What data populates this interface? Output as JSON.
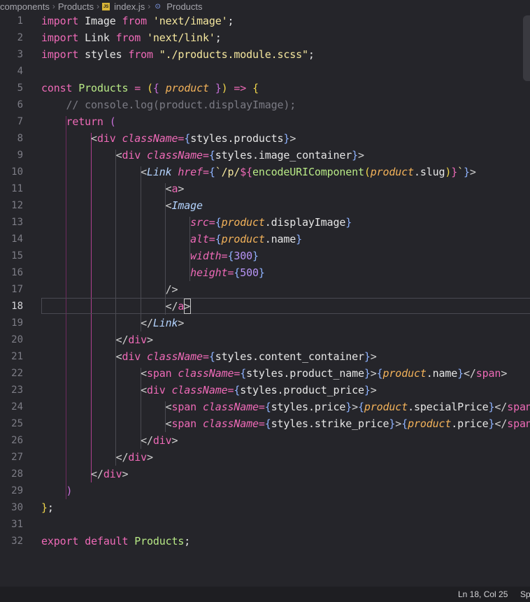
{
  "breadcrumb": {
    "items": [
      "components",
      "Products",
      "index.js",
      "Products"
    ],
    "file_badge": "JS"
  },
  "editor": {
    "active_line": 18,
    "lines": [
      {
        "n": "1",
        "tokens": [
          [
            "kw",
            "import"
          ],
          [
            "tx",
            " Image "
          ],
          [
            "kw",
            "from"
          ],
          [
            "tx",
            " "
          ],
          [
            "str",
            "'next/image'"
          ],
          [
            "tx",
            ";"
          ]
        ]
      },
      {
        "n": "2",
        "tokens": [
          [
            "kw",
            "import"
          ],
          [
            "tx",
            " Link "
          ],
          [
            "kw",
            "from"
          ],
          [
            "tx",
            " "
          ],
          [
            "str",
            "'next/link'"
          ],
          [
            "tx",
            ";"
          ]
        ]
      },
      {
        "n": "3",
        "tokens": [
          [
            "kw",
            "import"
          ],
          [
            "tx",
            " styles "
          ],
          [
            "kw",
            "from"
          ],
          [
            "tx",
            " "
          ],
          [
            "str",
            "\"./products.module.scss\""
          ],
          [
            "tx",
            ";"
          ]
        ]
      },
      {
        "n": "4",
        "tokens": []
      },
      {
        "n": "5",
        "tokens": [
          [
            "kw",
            "const"
          ],
          [
            "tx",
            " "
          ],
          [
            "fn",
            "Products"
          ],
          [
            "tx",
            " "
          ],
          [
            "kw",
            "="
          ],
          [
            "tx",
            " "
          ],
          [
            "br",
            "("
          ],
          [
            "br2",
            "{"
          ],
          [
            "tx",
            " "
          ],
          [
            "pm",
            "product"
          ],
          [
            "tx",
            " "
          ],
          [
            "br2",
            "}"
          ],
          [
            "br",
            ")"
          ],
          [
            "tx",
            " "
          ],
          [
            "kw",
            "=>"
          ],
          [
            "tx",
            " "
          ],
          [
            "br",
            "{"
          ]
        ]
      },
      {
        "n": "6",
        "tokens": [
          [
            "tx",
            "    "
          ],
          [
            "cm",
            "// console.log(product.displayImage);"
          ]
        ]
      },
      {
        "n": "7",
        "tokens": [
          [
            "tx",
            "    "
          ],
          [
            "kw",
            "return"
          ],
          [
            "tx",
            " "
          ],
          [
            "br2",
            "("
          ]
        ]
      },
      {
        "n": "8",
        "tokens": [
          [
            "tx",
            "        "
          ],
          [
            "pu",
            "<"
          ],
          [
            "tag",
            "div"
          ],
          [
            "tx",
            " "
          ],
          [
            "attr",
            "className"
          ],
          [
            "kw",
            "="
          ],
          [
            "br3",
            "{"
          ],
          [
            "tx",
            "styles.products"
          ],
          [
            "br3",
            "}"
          ],
          [
            "pu",
            ">"
          ]
        ]
      },
      {
        "n": "9",
        "tokens": [
          [
            "tx",
            "            "
          ],
          [
            "pu",
            "<"
          ],
          [
            "tag",
            "div"
          ],
          [
            "tx",
            " "
          ],
          [
            "attr",
            "className"
          ],
          [
            "kw",
            "="
          ],
          [
            "br3",
            "{"
          ],
          [
            "tx",
            "styles.image_container"
          ],
          [
            "br3",
            "}"
          ],
          [
            "pu",
            ">"
          ]
        ]
      },
      {
        "n": "10",
        "tokens": [
          [
            "tx",
            "                "
          ],
          [
            "pu",
            "<"
          ],
          [
            "comp",
            "Link"
          ],
          [
            "tx",
            " "
          ],
          [
            "attr",
            "href"
          ],
          [
            "kw",
            "="
          ],
          [
            "br3",
            "{"
          ],
          [
            "str",
            "`/p/"
          ],
          [
            "kw",
            "${"
          ],
          [
            "fn",
            "encodeURIComponent"
          ],
          [
            "br",
            "("
          ],
          [
            "pm",
            "product"
          ],
          [
            "tx",
            ".slug"
          ],
          [
            "br",
            ")"
          ],
          [
            "kw",
            "}"
          ],
          [
            "str",
            "`"
          ],
          [
            "br3",
            "}"
          ],
          [
            "pu",
            ">"
          ]
        ]
      },
      {
        "n": "11",
        "tokens": [
          [
            "tx",
            "                    "
          ],
          [
            "pu",
            "<"
          ],
          [
            "tag",
            "a"
          ],
          [
            "pu",
            ">"
          ]
        ]
      },
      {
        "n": "12",
        "tokens": [
          [
            "tx",
            "                    "
          ],
          [
            "pu",
            "<"
          ],
          [
            "comp",
            "Image"
          ]
        ]
      },
      {
        "n": "13",
        "tokens": [
          [
            "tx",
            "                        "
          ],
          [
            "attr",
            "src"
          ],
          [
            "kw",
            "="
          ],
          [
            "br3",
            "{"
          ],
          [
            "pm",
            "product"
          ],
          [
            "tx",
            ".displayImage"
          ],
          [
            "br3",
            "}"
          ]
        ]
      },
      {
        "n": "14",
        "tokens": [
          [
            "tx",
            "                        "
          ],
          [
            "attr",
            "alt"
          ],
          [
            "kw",
            "="
          ],
          [
            "br3",
            "{"
          ],
          [
            "pm",
            "product"
          ],
          [
            "tx",
            ".name"
          ],
          [
            "br3",
            "}"
          ]
        ]
      },
      {
        "n": "15",
        "tokens": [
          [
            "tx",
            "                        "
          ],
          [
            "attr",
            "width"
          ],
          [
            "kw",
            "="
          ],
          [
            "br3",
            "{"
          ],
          [
            "num",
            "300"
          ],
          [
            "br3",
            "}"
          ]
        ]
      },
      {
        "n": "16",
        "tokens": [
          [
            "tx",
            "                        "
          ],
          [
            "attr",
            "height"
          ],
          [
            "kw",
            "="
          ],
          [
            "br3",
            "{"
          ],
          [
            "num",
            "500"
          ],
          [
            "br3",
            "}"
          ]
        ]
      },
      {
        "n": "17",
        "tokens": [
          [
            "tx",
            "                    "
          ],
          [
            "pu",
            "/>"
          ]
        ]
      },
      {
        "n": "18",
        "tokens": [
          [
            "tx",
            "                    "
          ],
          [
            "pu",
            "</"
          ],
          [
            "tag",
            "a"
          ],
          [
            "pu",
            ">"
          ]
        ]
      },
      {
        "n": "19",
        "tokens": [
          [
            "tx",
            "                "
          ],
          [
            "pu",
            "</"
          ],
          [
            "comp",
            "Link"
          ],
          [
            "pu",
            ">"
          ]
        ]
      },
      {
        "n": "20",
        "tokens": [
          [
            "tx",
            "            "
          ],
          [
            "pu",
            "</"
          ],
          [
            "tag",
            "div"
          ],
          [
            "pu",
            ">"
          ]
        ]
      },
      {
        "n": "21",
        "tokens": [
          [
            "tx",
            "            "
          ],
          [
            "pu",
            "<"
          ],
          [
            "tag",
            "div"
          ],
          [
            "tx",
            " "
          ],
          [
            "attr",
            "className"
          ],
          [
            "kw",
            "="
          ],
          [
            "br3",
            "{"
          ],
          [
            "tx",
            "styles.content_container"
          ],
          [
            "br3",
            "}"
          ],
          [
            "pu",
            ">"
          ]
        ]
      },
      {
        "n": "22",
        "tokens": [
          [
            "tx",
            "                "
          ],
          [
            "pu",
            "<"
          ],
          [
            "tag",
            "span"
          ],
          [
            "tx",
            " "
          ],
          [
            "attr",
            "className"
          ],
          [
            "kw",
            "="
          ],
          [
            "br3",
            "{"
          ],
          [
            "tx",
            "styles.product_name"
          ],
          [
            "br3",
            "}"
          ],
          [
            "pu",
            ">"
          ],
          [
            "br3",
            "{"
          ],
          [
            "pm",
            "product"
          ],
          [
            "tx",
            ".name"
          ],
          [
            "br3",
            "}"
          ],
          [
            "pu",
            "</"
          ],
          [
            "tag",
            "span"
          ],
          [
            "pu",
            ">"
          ]
        ]
      },
      {
        "n": "23",
        "tokens": [
          [
            "tx",
            "                "
          ],
          [
            "pu",
            "<"
          ],
          [
            "tag",
            "div"
          ],
          [
            "tx",
            " "
          ],
          [
            "attr",
            "className"
          ],
          [
            "kw",
            "="
          ],
          [
            "br3",
            "{"
          ],
          [
            "tx",
            "styles.product_price"
          ],
          [
            "br3",
            "}"
          ],
          [
            "pu",
            ">"
          ]
        ]
      },
      {
        "n": "24",
        "tokens": [
          [
            "tx",
            "                    "
          ],
          [
            "pu",
            "<"
          ],
          [
            "tag",
            "span"
          ],
          [
            "tx",
            " "
          ],
          [
            "attr",
            "className"
          ],
          [
            "kw",
            "="
          ],
          [
            "br3",
            "{"
          ],
          [
            "tx",
            "styles.price"
          ],
          [
            "br3",
            "}"
          ],
          [
            "pu",
            ">"
          ],
          [
            "br3",
            "{"
          ],
          [
            "pm",
            "product"
          ],
          [
            "tx",
            ".specialPrice"
          ],
          [
            "br3",
            "}"
          ],
          [
            "pu",
            "</"
          ],
          [
            "tag",
            "span"
          ],
          [
            "pu",
            ">"
          ]
        ]
      },
      {
        "n": "25",
        "tokens": [
          [
            "tx",
            "                    "
          ],
          [
            "pu",
            "<"
          ],
          [
            "tag",
            "span"
          ],
          [
            "tx",
            " "
          ],
          [
            "attr",
            "className"
          ],
          [
            "kw",
            "="
          ],
          [
            "br3",
            "{"
          ],
          [
            "tx",
            "styles.strike_price"
          ],
          [
            "br3",
            "}"
          ],
          [
            "pu",
            ">"
          ],
          [
            "br3",
            "{"
          ],
          [
            "pm",
            "product"
          ],
          [
            "tx",
            ".price"
          ],
          [
            "br3",
            "}"
          ],
          [
            "pu",
            "</"
          ],
          [
            "tag",
            "span"
          ],
          [
            "pu",
            ">"
          ]
        ]
      },
      {
        "n": "26",
        "tokens": [
          [
            "tx",
            "                "
          ],
          [
            "pu",
            "</"
          ],
          [
            "tag",
            "div"
          ],
          [
            "pu",
            ">"
          ]
        ]
      },
      {
        "n": "27",
        "tokens": [
          [
            "tx",
            "            "
          ],
          [
            "pu",
            "</"
          ],
          [
            "tag",
            "div"
          ],
          [
            "pu",
            ">"
          ]
        ]
      },
      {
        "n": "28",
        "tokens": [
          [
            "tx",
            "        "
          ],
          [
            "pu",
            "</"
          ],
          [
            "tag",
            "div"
          ],
          [
            "pu",
            ">"
          ]
        ]
      },
      {
        "n": "29",
        "tokens": [
          [
            "tx",
            "    "
          ],
          [
            "br2",
            ")"
          ]
        ]
      },
      {
        "n": "30",
        "tokens": [
          [
            "br",
            "}"
          ],
          [
            "tx",
            ";"
          ]
        ]
      },
      {
        "n": "31",
        "tokens": []
      },
      {
        "n": "32",
        "tokens": [
          [
            "kw",
            "export"
          ],
          [
            "tx",
            " "
          ],
          [
            "kw",
            "default"
          ],
          [
            "tx",
            " "
          ],
          [
            "fn",
            "Products"
          ],
          [
            "tx",
            ";"
          ]
        ]
      }
    ]
  },
  "statusbar": {
    "position": "Ln 18, Col 25",
    "spaces": "Sp"
  }
}
